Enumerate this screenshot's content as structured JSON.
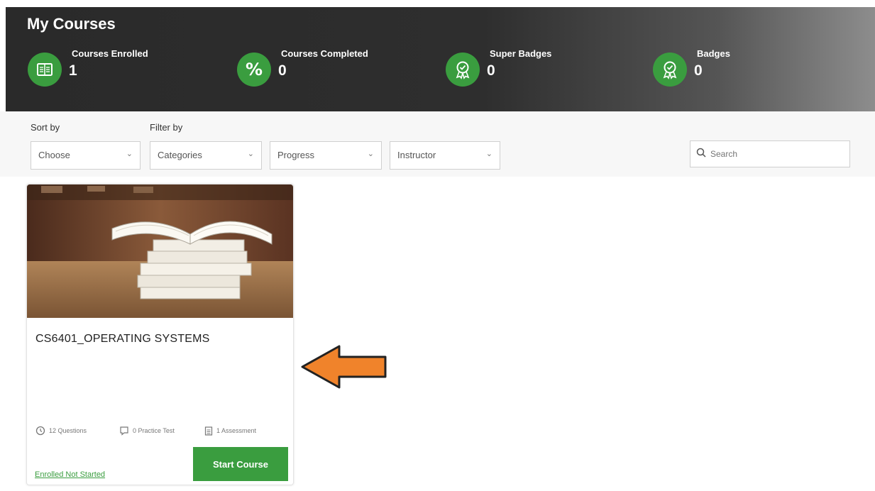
{
  "header": {
    "title": "My Courses",
    "stats": [
      {
        "label": "Courses Enrolled",
        "value": "1",
        "icon": "book-icon"
      },
      {
        "label": "Courses Completed",
        "value": "0",
        "icon": "percent-icon"
      },
      {
        "label": "Super Badges",
        "value": "0",
        "icon": "award-icon"
      },
      {
        "label": "Badges",
        "value": "0",
        "icon": "award-icon"
      }
    ]
  },
  "filters": {
    "sort_label": "Sort by",
    "filter_label": "Filter by",
    "sort_value": "Choose",
    "categories_value": "Categories",
    "progress_value": "Progress",
    "instructor_value": "Instructor",
    "search_placeholder": "Search"
  },
  "course": {
    "title": "CS6401_OPERATING SYSTEMS",
    "questions": "12 Questions",
    "practice": "0 Practice Test",
    "assessment": "1 Assessment",
    "status": "Enrolled Not Started",
    "button": "Start Course"
  },
  "colors": {
    "accent_green": "#3a9d3f",
    "header_dark": "#2a2a2a",
    "arrow_orange": "#f0832b"
  }
}
